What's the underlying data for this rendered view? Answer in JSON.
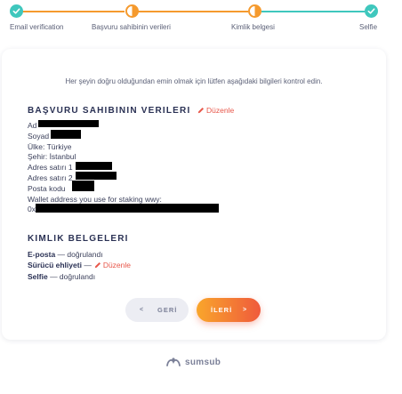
{
  "steps": [
    {
      "label": "Email verification",
      "status": "done"
    },
    {
      "label": "Başvuru sahibinin verileri",
      "status": "current"
    },
    {
      "label": "Kimlik belgesi",
      "status": "current"
    },
    {
      "label": "Selfie",
      "status": "done"
    }
  ],
  "colors": {
    "accent": "#3fc7bd",
    "warning": "#f59a2e",
    "edit": "#e8574a"
  },
  "intro": "Her şeyin doğru olduğundan emin olmak için lütfen aşağıdaki bilgileri kontrol edin.",
  "applicant": {
    "title": "Başvuru sahibinin verileri",
    "edit_label": "Düzenle",
    "fields": {
      "ad": "Ad",
      "soyad": "Soyad",
      "ulke": "Ülke: Türkiye",
      "sehir": "Şehir: İstanbul",
      "adres1": "Adres satırı 1",
      "adres2": "Adres satırı 2",
      "posta": "Posta kodu",
      "wallet": "Wallet address you use for staking wwy:",
      "wallet_prefix": "0x"
    }
  },
  "documents": {
    "title": "Kimlik belgeleri",
    "items": [
      {
        "name": "E-posta",
        "status": "— doğrulandı"
      },
      {
        "name": "Sürücü ehliyeti",
        "status": "—"
      },
      {
        "name": "Selfie",
        "status": "— doğrulandı"
      }
    ],
    "edit_label": "Düzenle"
  },
  "buttons": {
    "back": "GERİ",
    "back_arrow": "<",
    "next": "İLERİ",
    "next_arrow": ">"
  },
  "footer": {
    "brand": "sumsub"
  }
}
